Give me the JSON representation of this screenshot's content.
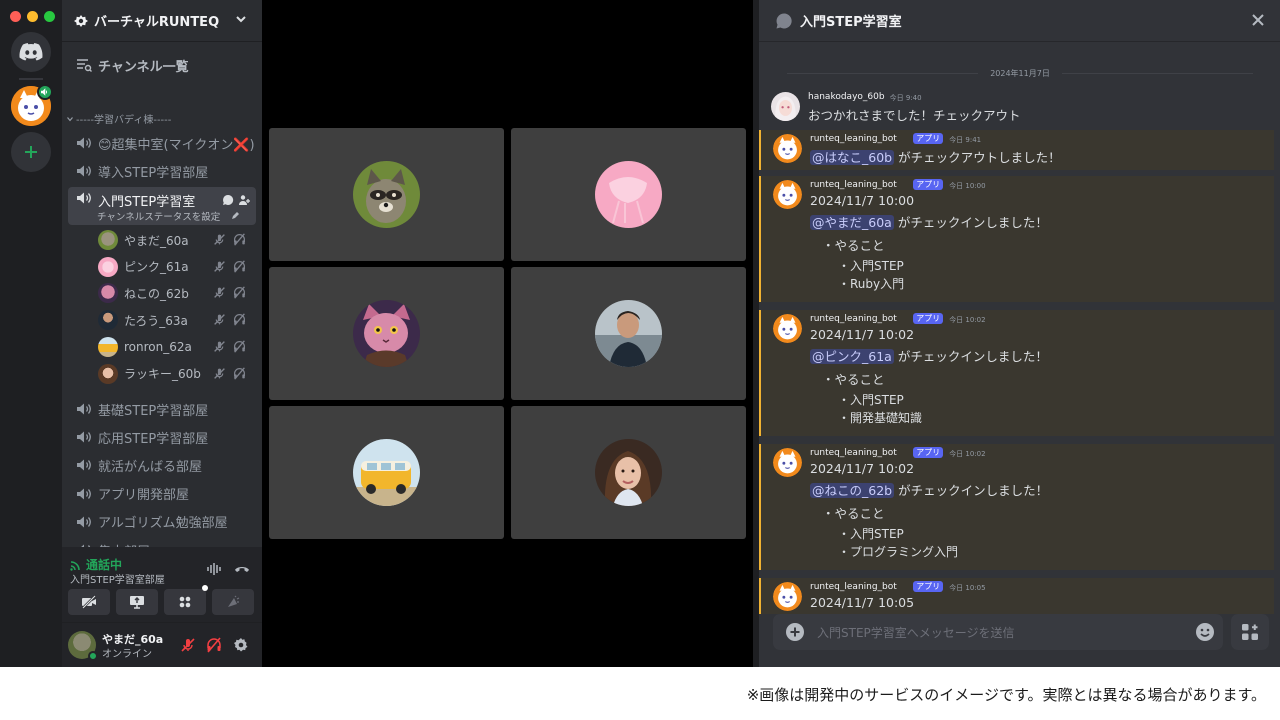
{
  "colors": {
    "accent": "#5865f2",
    "online": "#23a55a",
    "highlight": "#f0b232",
    "danger": "#f23f42"
  },
  "server": {
    "name": "バーチャルRUNTEQ"
  },
  "sidebar": {
    "browse_label": "チャンネル一覧",
    "category": "-----学習バディ棟-----",
    "channels_top": [
      {
        "label": "😊超集中室(マイクオン❌)"
      },
      {
        "label": "導入STEP学習部屋"
      }
    ],
    "active_channel": {
      "label": "入門STEP学習室",
      "sub": "チャンネルステータスを設定"
    },
    "voice_members": [
      {
        "name": "やまだ_60a",
        "avatar": "raccoon"
      },
      {
        "name": "ピンク_61a",
        "avatar": "pink-chair"
      },
      {
        "name": "ねこの_62b",
        "avatar": "cat"
      },
      {
        "name": "たろう_63a",
        "avatar": "man"
      },
      {
        "name": "ronron_62a",
        "avatar": "van"
      },
      {
        "name": "ラッキー_60b",
        "avatar": "woman"
      }
    ],
    "channels_bottom": [
      {
        "label": "基礎STEP学習部屋"
      },
      {
        "label": "応用STEP学習部屋"
      },
      {
        "label": "就活がんばる部屋"
      },
      {
        "label": "アプリ開発部屋"
      },
      {
        "label": "アルゴリズム勉強部屋"
      },
      {
        "label": "集中部屋"
      }
    ]
  },
  "voice_panel": {
    "status": "通話中",
    "channel": "入門STEP学習室部屋"
  },
  "user_panel": {
    "name": "やまだ_60a",
    "status": "オンライン"
  },
  "chat": {
    "title": "入門STEP学習室",
    "date_divider": "2024年11月7日",
    "input_placeholder": "入門STEP学習室へメッセージを送信",
    "messages": [
      {
        "author": "hanakodayo_60b",
        "time": "今日 9:40",
        "lines": [
          "おつかれさまでした！チェックアウト"
        ]
      },
      {
        "author": "runteq_leaning_bot",
        "tag": "アプリ",
        "time": "今日 9:41",
        "mention": "@はなこ_60b",
        "text": "がチェックアウトしました！"
      },
      {
        "author": "runteq_leaning_bot",
        "tag": "アプリ",
        "time": "今日 10:00",
        "datetime": "2024/11/7 10:00",
        "mention": "@やまだ_60a",
        "text": "がチェックインしました！",
        "todo_label": "・やること",
        "todos": [
          "・入門STEP",
          "・Ruby入門"
        ]
      },
      {
        "author": "runteq_leaning_bot",
        "tag": "アプリ",
        "time": "今日 10:02",
        "datetime": "2024/11/7 10:02",
        "mention": "@ピンク_61a",
        "text": "がチェックインしました！",
        "todo_label": "・やること",
        "todos": [
          "・入門STEP",
          "・開発基礎知識"
        ]
      },
      {
        "author": "runteq_leaning_bot",
        "tag": "アプリ",
        "time": "今日 10:02",
        "datetime": "2024/11/7 10:02",
        "mention": "@ねこの_62b",
        "text": "がチェックインしました！",
        "todo_label": "・やること",
        "todos": [
          "・入門STEP",
          "・プログラミング入門"
        ]
      },
      {
        "author": "runteq_leaning_bot",
        "tag": "アプリ",
        "time": "今日 10:05",
        "datetime": "2024/11/7 10:05"
      }
    ]
  },
  "disclaimer": "※画像は開発中のサービスのイメージです。実際とは異なる場合があります。"
}
